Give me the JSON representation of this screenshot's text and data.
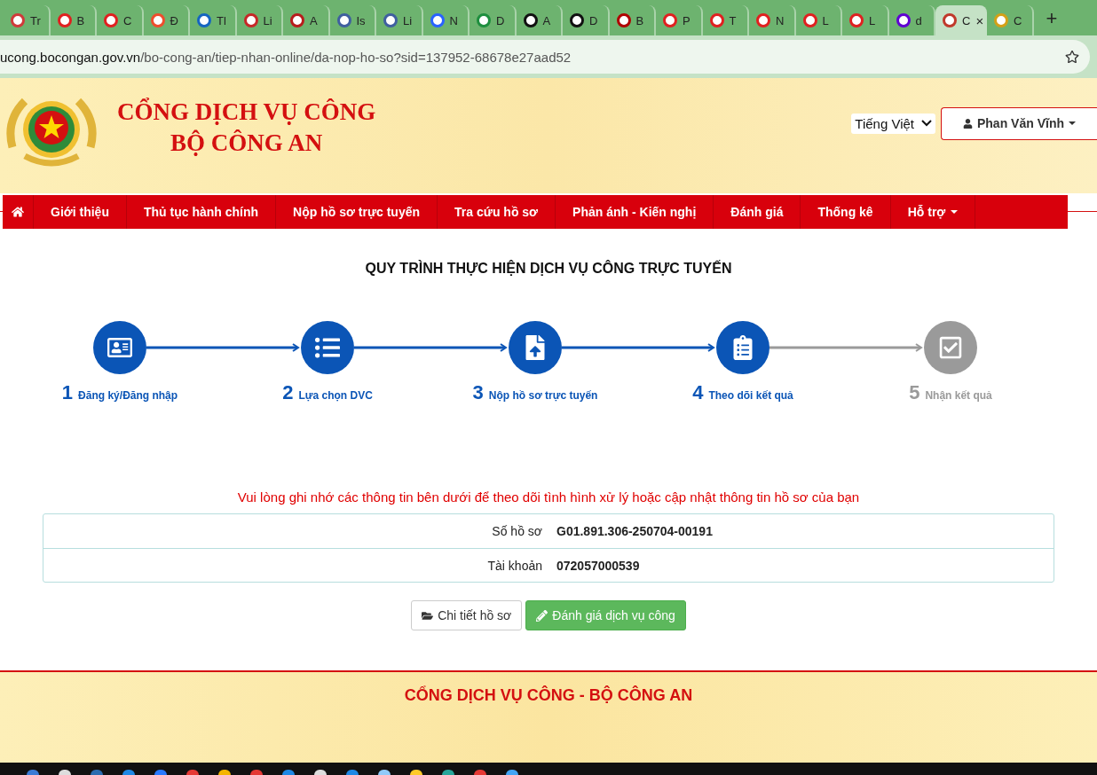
{
  "browser": {
    "tabs": [
      {
        "label": "Tr",
        "color": "#d03a3a",
        "selected": false
      },
      {
        "label": "B",
        "color": "#e02020",
        "selected": false
      },
      {
        "label": "C",
        "color": "#e02020",
        "selected": false
      },
      {
        "label": "Đ",
        "color": "#ee4d2d",
        "selected": false
      },
      {
        "label": "Tl",
        "color": "#1565c0",
        "selected": false
      },
      {
        "label": "Li",
        "color": "#c62828",
        "selected": false
      },
      {
        "label": "A",
        "color": "#b71c1c",
        "selected": false
      },
      {
        "label": "Is",
        "color": "#3f5f9f",
        "selected": false
      },
      {
        "label": "Li",
        "color": "#3f5f9f",
        "selected": false
      },
      {
        "label": "N",
        "color": "#2962ff",
        "selected": false
      },
      {
        "label": "D",
        "color": "#1e8e3e",
        "selected": false
      },
      {
        "label": "A",
        "color": "#111111",
        "selected": false
      },
      {
        "label": "D",
        "color": "#111111",
        "selected": false
      },
      {
        "label": "B",
        "color": "#b00000",
        "selected": false
      },
      {
        "label": "P",
        "color": "#e02020",
        "selected": false
      },
      {
        "label": "T",
        "color": "#e02020",
        "selected": false
      },
      {
        "label": "N",
        "color": "#e02020",
        "selected": false
      },
      {
        "label": "L",
        "color": "#e02020",
        "selected": false
      },
      {
        "label": "L",
        "color": "#e02020",
        "selected": false
      },
      {
        "label": "d",
        "color": "#6001d2",
        "selected": false
      },
      {
        "label": "C",
        "color": "#c0392b",
        "selected": true
      },
      {
        "label": "C",
        "color": "#d4a017",
        "selected": false
      }
    ],
    "new_tab": "+",
    "close_tab": "×",
    "address": {
      "host": "ucong.bocongan.gov.vn",
      "path": "/bo-cong-an/tiep-nhan-online/da-nop-ho-so?sid=137952-68678e27aad52"
    }
  },
  "header": {
    "title_line_1": "CỔNG DỊCH VỤ CÔNG",
    "title_line_2": "BỘ CÔNG AN",
    "language": "Tiếng Việt",
    "user": "Phan Văn Vĩnh"
  },
  "nav": {
    "items": [
      {
        "kind": "home"
      },
      {
        "kind": "link",
        "label": "Giới thiệu"
      },
      {
        "kind": "link",
        "label": "Thủ tục hành chính"
      },
      {
        "kind": "link",
        "label": "Nộp hồ sơ trực tuyến"
      },
      {
        "kind": "link",
        "label": "Tra cứu hồ sơ"
      },
      {
        "kind": "link",
        "label": "Phản ánh - Kiến nghị"
      },
      {
        "kind": "link",
        "label": "Đánh giá"
      },
      {
        "kind": "link",
        "label": "Thống kê"
      },
      {
        "kind": "dropdown",
        "label": "Hỗ trợ"
      }
    ]
  },
  "process": {
    "title": "QUY TRÌNH THỰC HIỆN DỊCH VỤ CÔNG TRỰC TUYẾN",
    "steps": [
      {
        "number": "1",
        "label": "Đăng ký/Đăng nhập",
        "done": true
      },
      {
        "number": "2",
        "label": "Lựa chọn DVC",
        "done": true
      },
      {
        "number": "3",
        "label": "Nộp hồ sơ trực tuyến",
        "done": true
      },
      {
        "number": "4",
        "label": "Theo dõi kết quả",
        "done": true
      },
      {
        "number": "5",
        "label": "Nhận kết quả",
        "done": false
      }
    ]
  },
  "notice": "Vui lòng ghi nhớ các thông tin bên dưới để theo dõi tình hình xử lý hoặc cập nhật thông tin hồ sơ của bạn",
  "info": [
    {
      "label": "Số hồ sơ",
      "value": "G01.891.306-250704-00191"
    },
    {
      "label": "Tài khoản",
      "value": "072057000539"
    }
  ],
  "buttons": [
    {
      "kind": "default",
      "label": "Chi tiết hồ sơ"
    },
    {
      "kind": "success",
      "label": "Đánh giá dịch vụ công"
    }
  ],
  "footer": {
    "title": "CỔNG DỊCH VỤ CÔNG - BỘ CÔNG AN"
  }
}
